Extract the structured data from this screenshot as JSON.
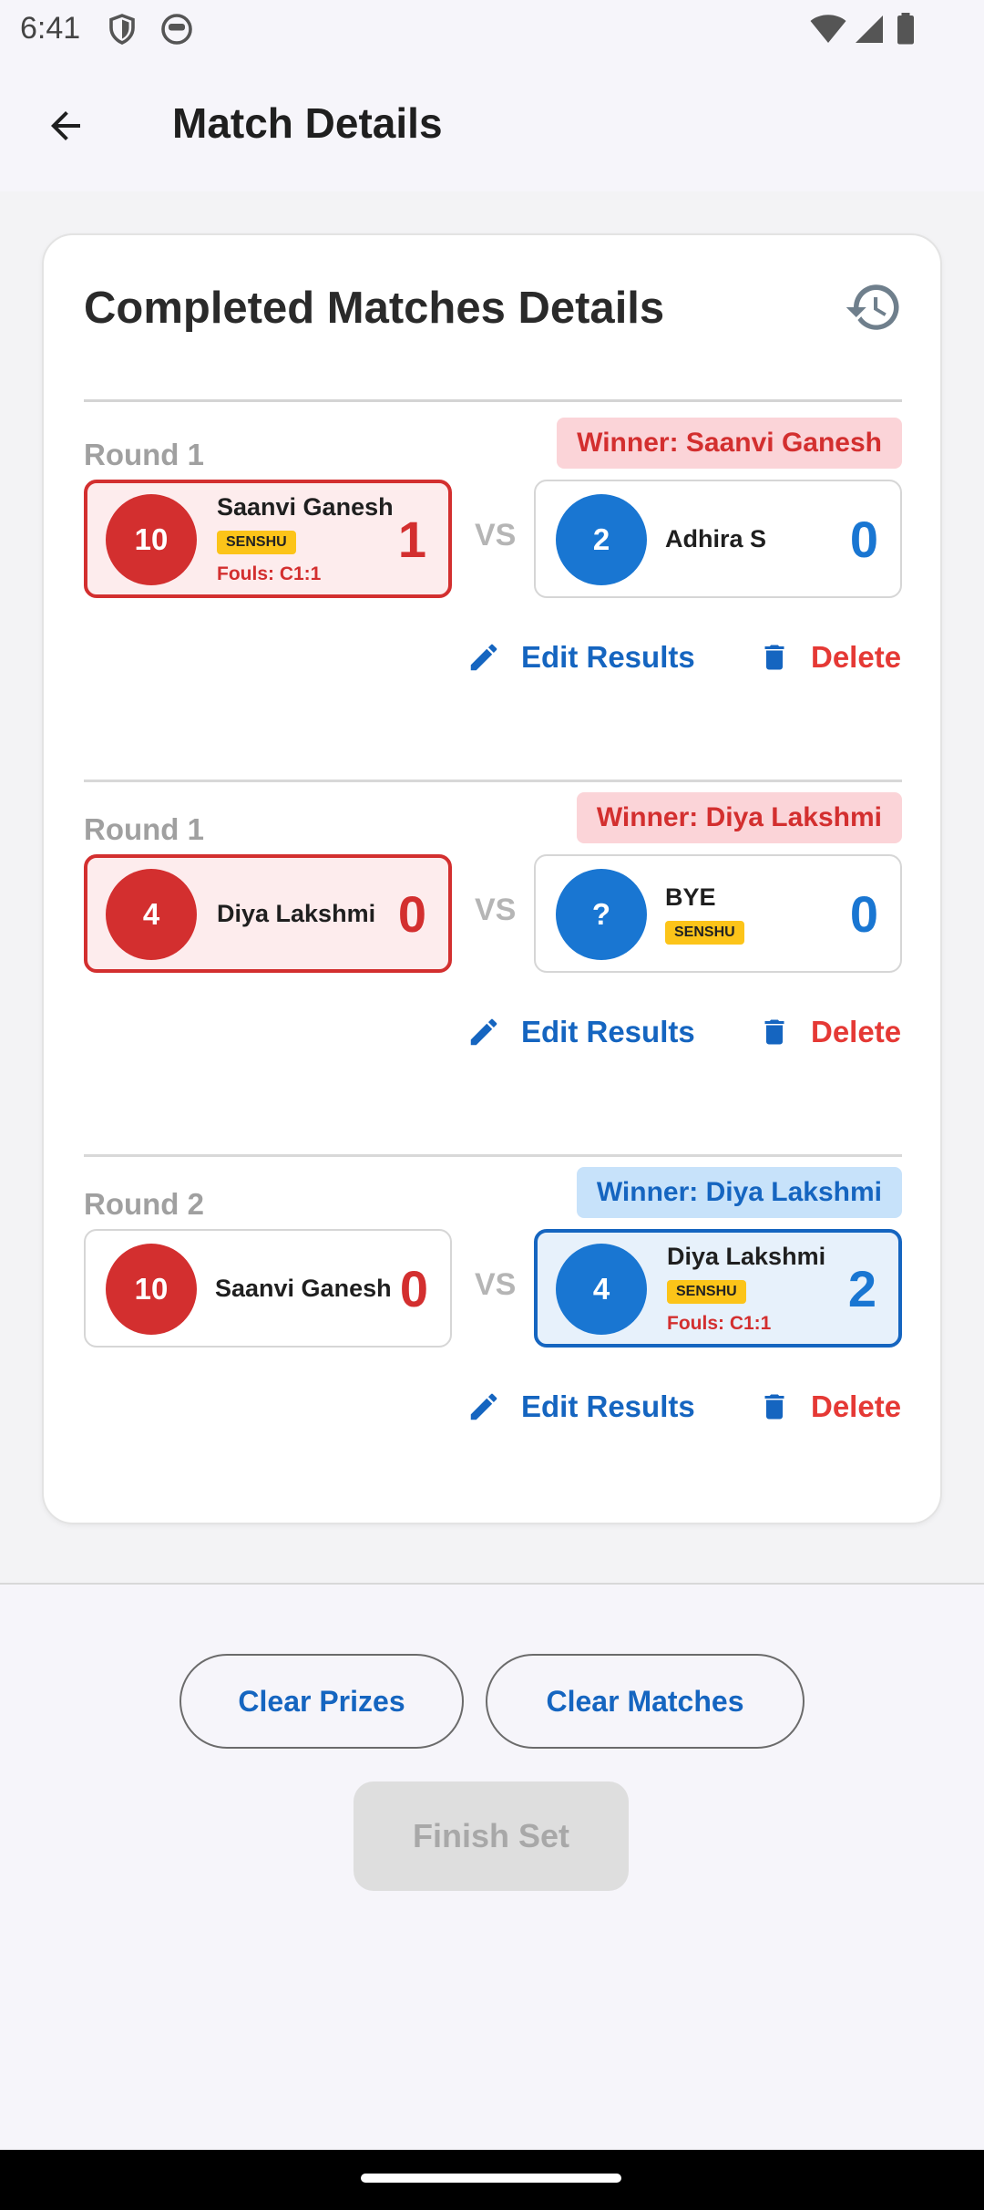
{
  "status_bar": {
    "time": "6:41"
  },
  "app_bar": {
    "title": "Match Details"
  },
  "card": {
    "title": "Completed Matches Details",
    "matches": [
      {
        "round": "Round 1",
        "winner": "Winner: Saanvi Ganesh",
        "left": {
          "number": "10",
          "name": "Saanvi Ganesh",
          "senshu": "SENSHU",
          "fouls": "Fouls: C1:1",
          "score": "1"
        },
        "right": {
          "number": "2",
          "name": "Adhira S",
          "score": "0"
        },
        "vs": "VS",
        "edit_label": "Edit Results",
        "delete_label": "Delete"
      },
      {
        "round": "Round 1",
        "winner": "Winner: Diya Lakshmi",
        "left": {
          "number": "4",
          "name": "Diya Lakshmi",
          "score": "0"
        },
        "right": {
          "number": "?",
          "name": "BYE",
          "senshu": "SENSHU",
          "score": "0"
        },
        "vs": "VS",
        "edit_label": "Edit Results",
        "delete_label": "Delete"
      },
      {
        "round": "Round 2",
        "winner": "Winner: Diya Lakshmi",
        "left": {
          "number": "10",
          "name": "Saanvi Ganesh",
          "score": "0"
        },
        "right": {
          "number": "4",
          "name": "Diya Lakshmi",
          "senshu": "SENSHU",
          "fouls": "Fouls: C1:1",
          "score": "2"
        },
        "vs": "VS",
        "edit_label": "Edit Results",
        "delete_label": "Delete"
      }
    ]
  },
  "actions": {
    "clear_prizes": "Clear Prizes",
    "clear_matches": "Clear Matches",
    "finish_set": "Finish Set"
  },
  "colors": {
    "aka_red": "#d32f2f",
    "ao_blue": "#1976d2",
    "link_blue": "#1565c0",
    "delete_red": "#e53935",
    "senshu_yellow": "#fcc419"
  }
}
